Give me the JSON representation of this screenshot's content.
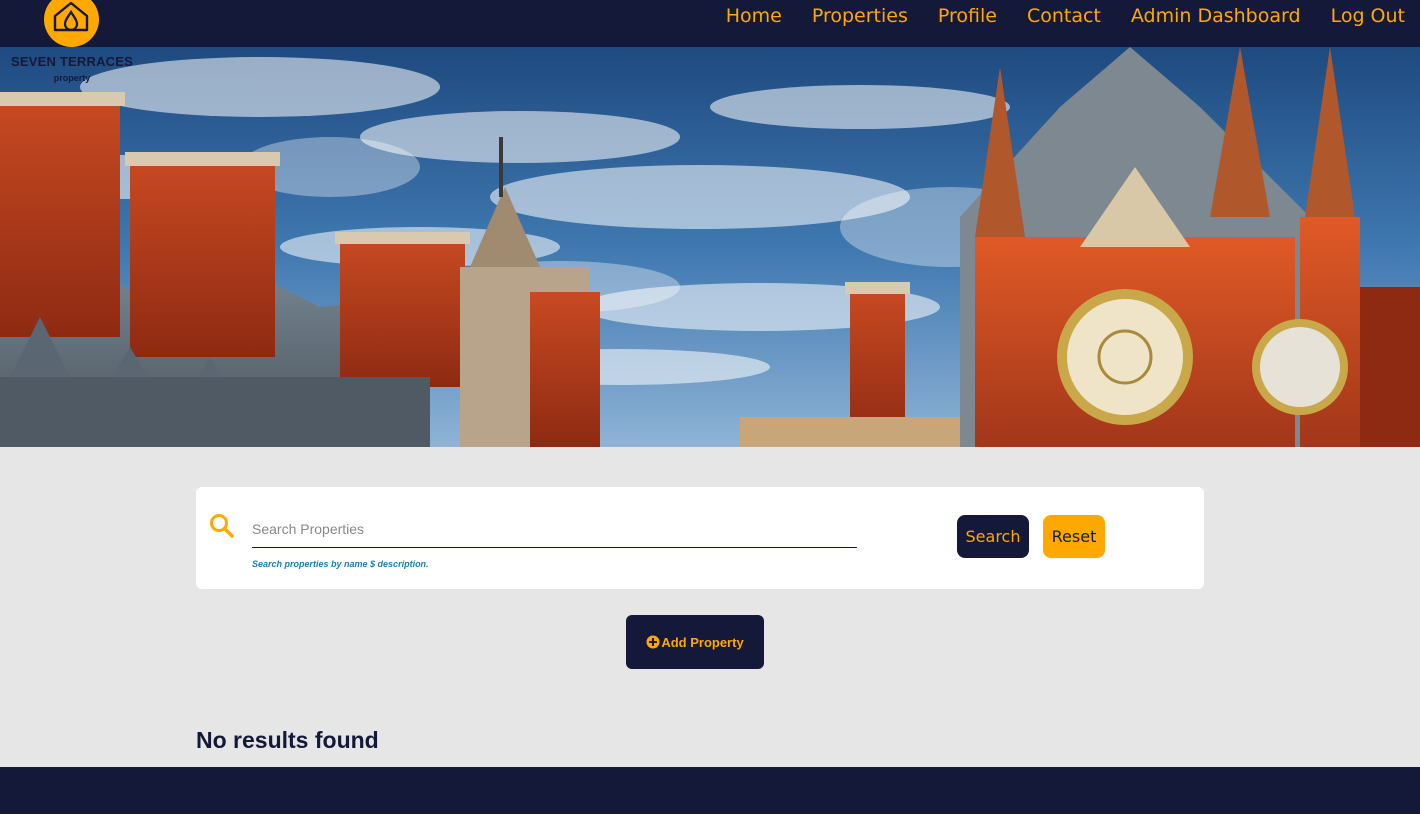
{
  "brand": {
    "name": "SEVEN TERRACES",
    "tagline": "property"
  },
  "nav": {
    "items": [
      {
        "label": "Home"
      },
      {
        "label": "Properties"
      },
      {
        "label": "Profile"
      },
      {
        "label": "Contact"
      },
      {
        "label": "Admin Dashboard"
      },
      {
        "label": "Log Out"
      }
    ]
  },
  "hero": {
    "image": "gothic-brick-building-clock-tower-image"
  },
  "search": {
    "icon": "search-icon",
    "placeholder": "Search Properties",
    "value": "",
    "hint": "Search properties by name $ description.",
    "search_label": "Search",
    "reset_label": "Reset"
  },
  "actions": {
    "add_icon": "plus-circle-icon",
    "add_label": "Add Property"
  },
  "results": {
    "message": "No results found"
  },
  "colors": {
    "navy": "#14193a",
    "accent": "#ffa800",
    "background": "#e6e6e6",
    "hint": "#1a7fa8"
  }
}
